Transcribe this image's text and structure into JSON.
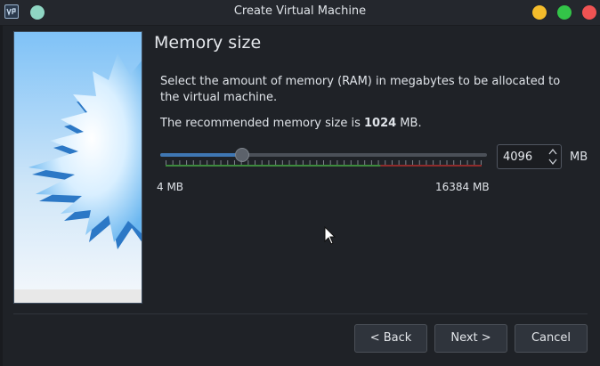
{
  "window": {
    "title": "Create Virtual Machine",
    "controls": {
      "minimize_color": "#f4bc2b",
      "maximize_color": "#33c448",
      "close_color": "#f05353"
    },
    "pin_color": "#8fd6c3"
  },
  "page": {
    "title": "Memory size",
    "description": "Select the amount of memory (RAM) in megabytes to be allocated to the virtual machine.",
    "recommend_prefix": "The recommended memory size is ",
    "recommend_value": "1024",
    "recommend_suffix": " MB."
  },
  "memory": {
    "min_label": "4 MB",
    "max_label": "16384 MB",
    "min": 4,
    "max": 16384,
    "value": "4096",
    "unit": "MB",
    "colors": {
      "accent": "#3f77b3",
      "safe": "#3d8a3d",
      "danger": "#8f2b2b"
    }
  },
  "buttons": {
    "back": "< Back",
    "next": "Next >",
    "cancel": "Cancel"
  },
  "icons": {
    "app": "virtualbox-icon",
    "pin": "pin-icon",
    "spin_up": "chevron-up-icon",
    "spin_down": "chevron-down-icon",
    "cursor": "mouse-pointer-icon"
  }
}
